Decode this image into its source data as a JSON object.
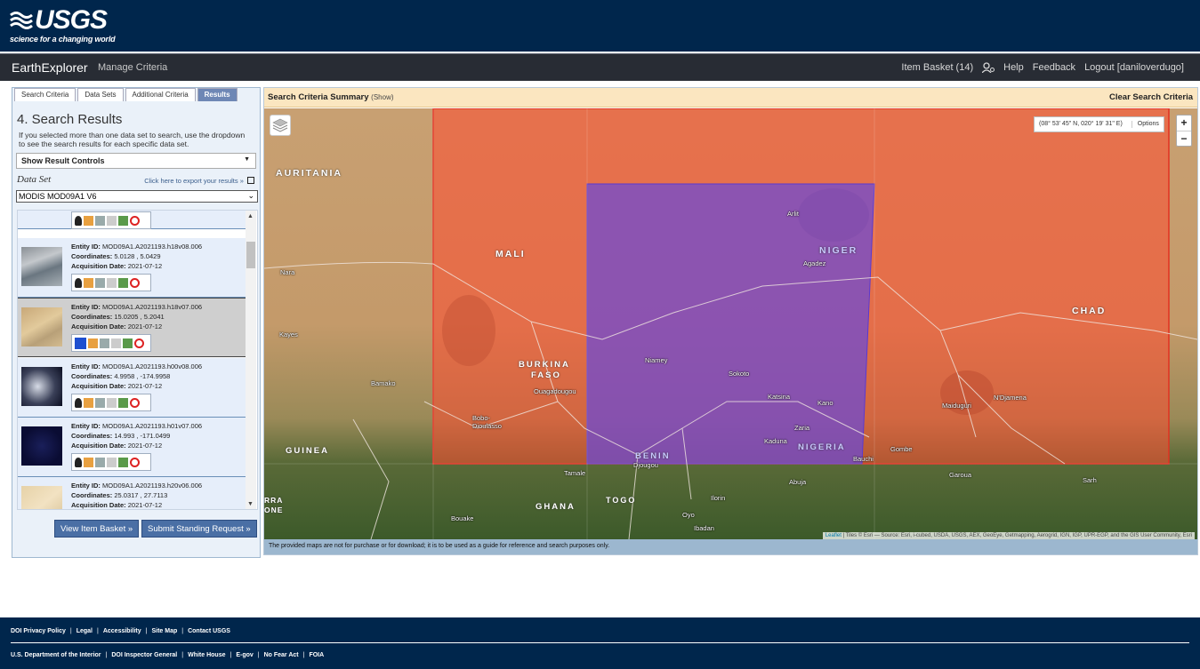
{
  "banner": {
    "logo_text": "USGS",
    "tagline": "science for a changing world"
  },
  "nav": {
    "brand": "EarthExplorer",
    "manage_criteria": "Manage Criteria",
    "item_basket": "Item Basket (14)",
    "help": "Help",
    "feedback": "Feedback",
    "logout": "Logout [daniloverdugo]"
  },
  "tabs": [
    "Search Criteria",
    "Data Sets",
    "Additional Criteria",
    "Results"
  ],
  "results": {
    "title": "4. Search Results",
    "description": "If you selected more than one data set to search, use the dropdown to see the search results for each specific data set.",
    "controls_label": "Show Result Controls",
    "dataset_label": "Data Set",
    "export_link": "Click here to export your results »",
    "dataset_selected": "MODIS MOD09A1 V6",
    "items": [
      {
        "entity_id": "MOD09A1.A2021193.h18v08.006",
        "coordinates": "5.0128 , 5.0429",
        "acquisition_date": "2021-07-12",
        "selected": false
      },
      {
        "entity_id": "MOD09A1.A2021193.h18v07.006",
        "coordinates": "15.0205 , 5.2041",
        "acquisition_date": "2021-07-12",
        "selected": true
      },
      {
        "entity_id": "MOD09A1.A2021193.h00v08.006",
        "coordinates": "4.9958 , -174.9958",
        "acquisition_date": "2021-07-12",
        "selected": false
      },
      {
        "entity_id": "MOD09A1.A2021193.h01v07.006",
        "coordinates": "14.993 , -171.0499",
        "acquisition_date": "2021-07-12",
        "selected": false
      },
      {
        "entity_id": "MOD09A1.A2021193.h20v06.006",
        "coordinates": "25.0317 , 27.7113",
        "acquisition_date": "2021-07-12",
        "selected": false
      }
    ],
    "field_labels": {
      "entity": "Entity ID:",
      "coords": "Coordinates:",
      "date": "Acquisition Date:"
    },
    "view_basket": "View Item Basket »",
    "standing_request": "Submit Standing Request »"
  },
  "map": {
    "criteria_summary": "Search Criteria Summary",
    "criteria_show": "(Show)",
    "clear_criteria": "Clear Search Criteria",
    "coordinates": "(08° 53' 45\" N, 020° 19' 31\" E)",
    "options": "Options",
    "zoom_in": "+",
    "zoom_out": "−",
    "countries": {
      "mauritania": "AURITANIA",
      "mali": "MALI",
      "niger": "NIGER",
      "chad": "CHAD",
      "burkina": "BURKINA",
      "faso": "FASO",
      "guinea": "GUINEA",
      "benin": "BENIN",
      "nigeria": "NIGERIA",
      "ghana": "GHANA",
      "togo": "TOGO",
      "sierra": "RRA",
      "leone": "ONE"
    },
    "cities": {
      "nara": "Nara",
      "kayes": "Kayes",
      "bamako": "Bamako",
      "ouagadougou": "Ouagadougou",
      "bobo": "Bobo-",
      "dioulasso": "Dioulasso",
      "niamey": "Niamey",
      "arlit": "Arlit",
      "agadez": "Agadez",
      "sokoto": "Sokoto",
      "katsina": "Katsina",
      "kano": "Kano",
      "zaria": "Zaria",
      "kaduna": "Kaduna",
      "bauchi": "Bauchi",
      "gombe": "Gombe",
      "maiduguri": "Maiduguri",
      "ndjamena": "N'Djamena",
      "djougou": "Djougou",
      "tamale": "Tamale",
      "abuja": "Abuja",
      "ilorin": "Ilorin",
      "oyo": "Oyo",
      "ibadan": "Ibadan",
      "bouake": "Bouake",
      "garoua": "Garoua",
      "sarh": "Sarh"
    },
    "attribution_leaflet": "Leaflet",
    "attribution_text": "| Tiles © Esri — Source: Esri, i-cubed, USDA, USGS, AEX, GeoEye, Getmapping, Aerogrid, IGN, IGP, UPR-EGP, and the GIS User Community, Esri",
    "disclaimer": "The provided maps are not for purchase or for download; it is to be used as a guide for reference and search purposes only."
  },
  "footer": {
    "row1": [
      "DOI Privacy Policy",
      "Legal",
      "Accessibility",
      "Site Map",
      "Contact USGS"
    ],
    "row2": [
      "U.S. Department of the Interior",
      "DOI Inspector General",
      "White House",
      "E-gov",
      "No Fear Act",
      "FOIA"
    ]
  },
  "colors": {
    "banner": "#00264c",
    "nav": "#282c34",
    "overlay_red": "#ff4a30",
    "overlay_purple": "#6a4ad8"
  }
}
